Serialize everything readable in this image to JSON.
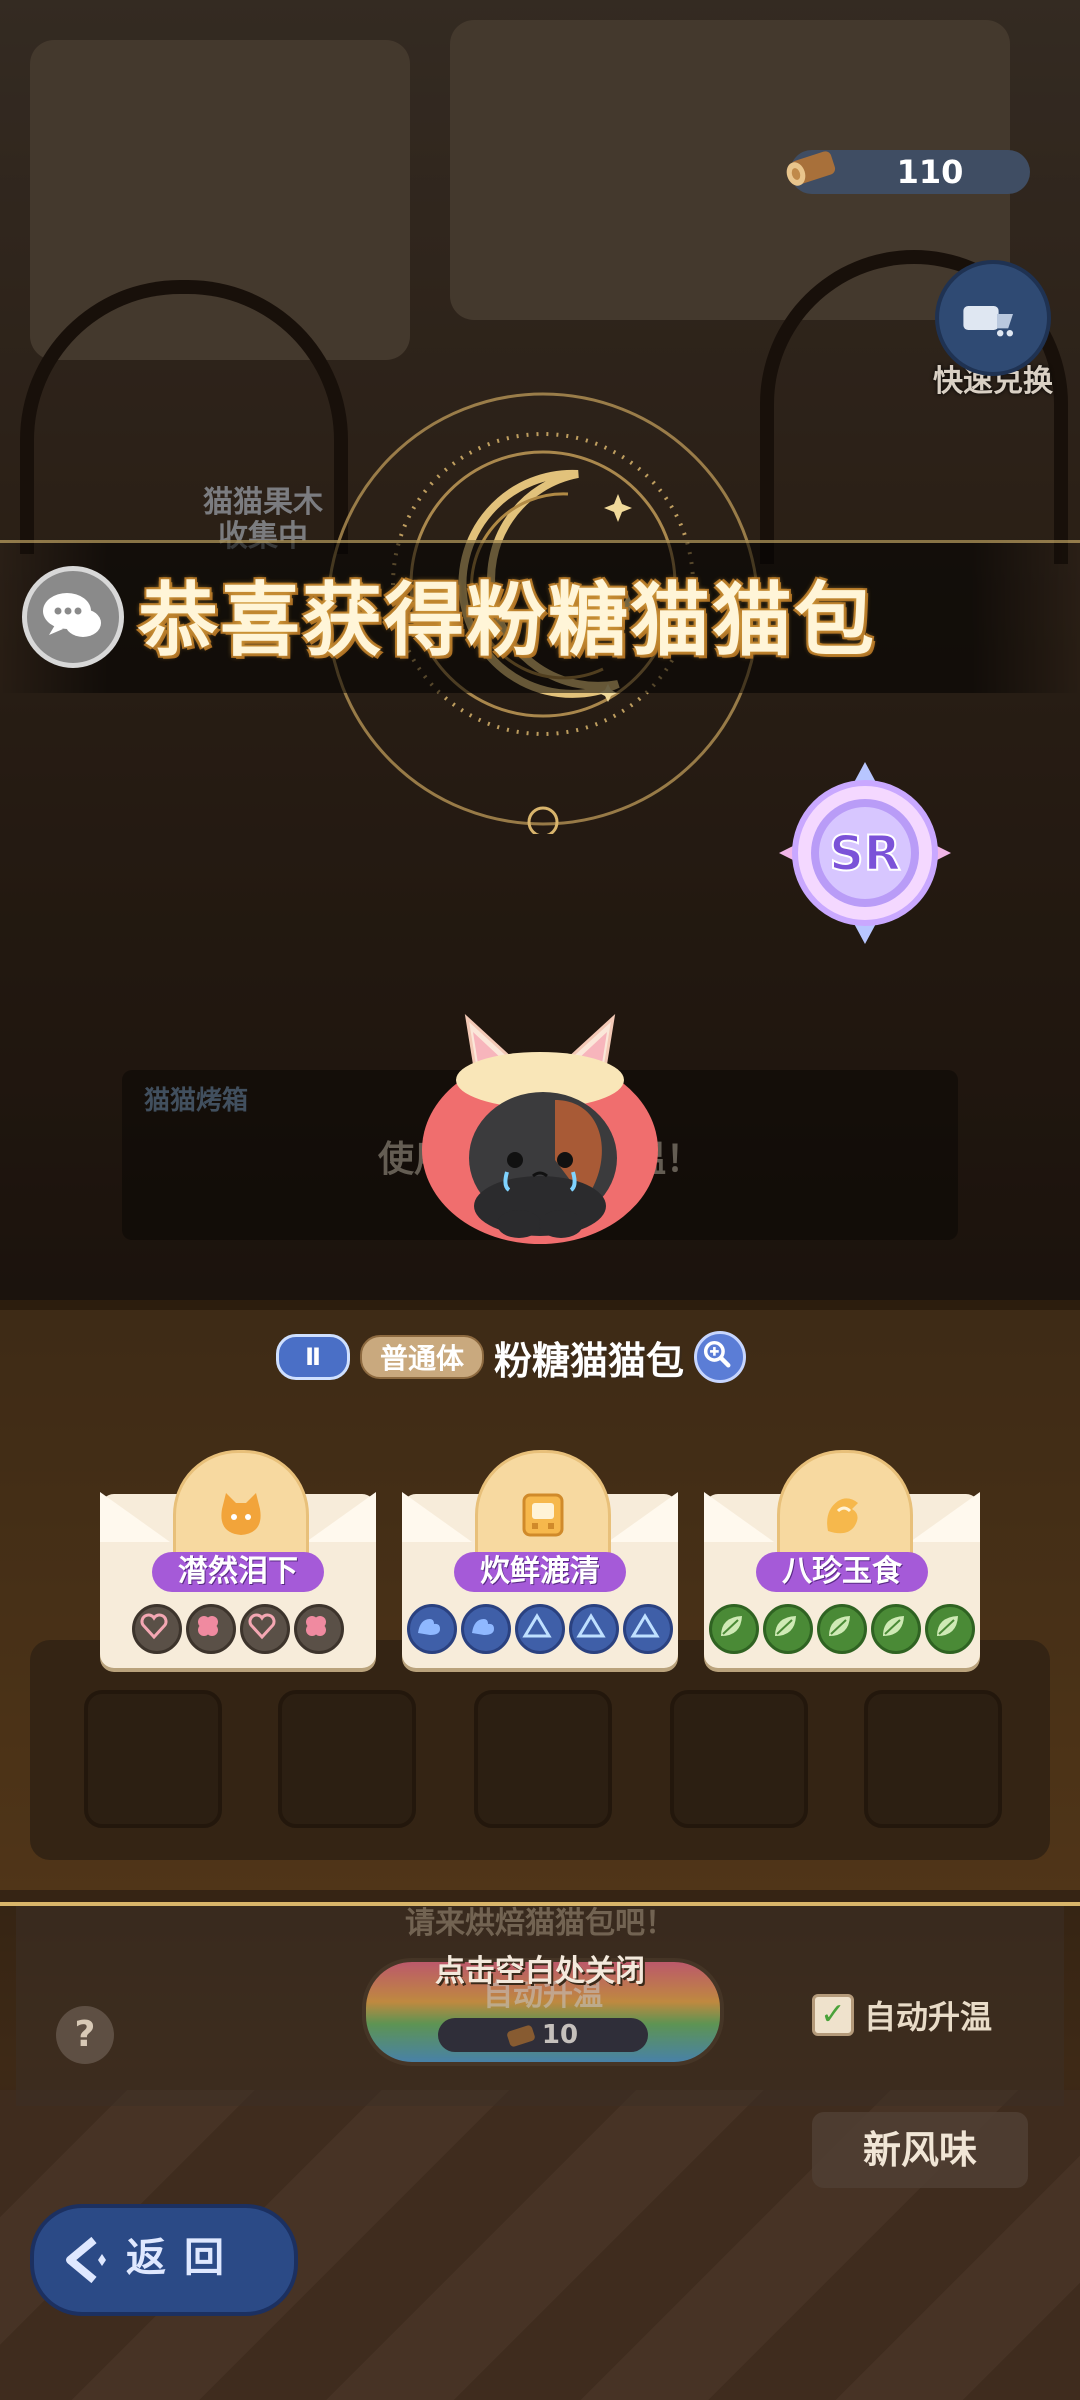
{
  "hud": {
    "wood_count": "110",
    "quick_exchange_label": "快速兑换"
  },
  "background": {
    "collecting_label": "猫猫果木\n收集中",
    "oven_label": "猫猫烤箱",
    "oven_hint": "使用猫猫果木升温！",
    "bake_hint": "请来烘焙猫猫包吧！",
    "auto_heat_button": "自动升温",
    "auto_heat_cost": "10",
    "auto_heat_toggle": "自动升温",
    "new_flavor_button": "新风味",
    "back_button": "返回",
    "help_button": "?"
  },
  "reward": {
    "banner_title": "恭喜获得粉糖猫猫包",
    "rarity": "SR",
    "tier": "Ⅱ",
    "body_type": "普通体",
    "name": "粉糖猫猫包",
    "close_hint": "点击空白处关闭"
  },
  "traits": [
    {
      "title": "潸然泪下",
      "icons": [
        "heart-icon",
        "brain-icon",
        "heart-icon",
        "brain-icon"
      ]
    },
    {
      "title": "炊鲜漉清",
      "icons": [
        "muscle-icon",
        "muscle-icon",
        "triangle-icon",
        "triangle-icon",
        "triangle-icon"
      ]
    },
    {
      "title": "八珍玉食",
      "icons": [
        "leaf-icon",
        "leaf-icon",
        "leaf-icon",
        "leaf-icon",
        "leaf-icon"
      ]
    }
  ],
  "colors": {
    "trait_title_bg": "#a55ad8",
    "rarity_ring": "#8fa2ff",
    "banner_gold": "#d9a33f"
  }
}
